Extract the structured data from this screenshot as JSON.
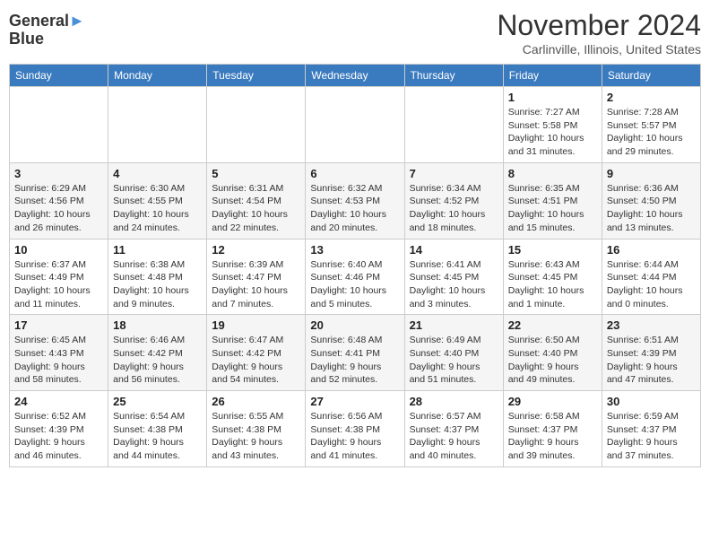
{
  "logo": {
    "line1": "General",
    "line2": "Blue"
  },
  "title": "November 2024",
  "location": "Carlinville, Illinois, United States",
  "weekdays": [
    "Sunday",
    "Monday",
    "Tuesday",
    "Wednesday",
    "Thursday",
    "Friday",
    "Saturday"
  ],
  "weeks": [
    [
      {
        "day": "",
        "info": ""
      },
      {
        "day": "",
        "info": ""
      },
      {
        "day": "",
        "info": ""
      },
      {
        "day": "",
        "info": ""
      },
      {
        "day": "",
        "info": ""
      },
      {
        "day": "1",
        "info": "Sunrise: 7:27 AM\nSunset: 5:58 PM\nDaylight: 10 hours and 31 minutes."
      },
      {
        "day": "2",
        "info": "Sunrise: 7:28 AM\nSunset: 5:57 PM\nDaylight: 10 hours and 29 minutes."
      }
    ],
    [
      {
        "day": "3",
        "info": "Sunrise: 6:29 AM\nSunset: 4:56 PM\nDaylight: 10 hours and 26 minutes."
      },
      {
        "day": "4",
        "info": "Sunrise: 6:30 AM\nSunset: 4:55 PM\nDaylight: 10 hours and 24 minutes."
      },
      {
        "day": "5",
        "info": "Sunrise: 6:31 AM\nSunset: 4:54 PM\nDaylight: 10 hours and 22 minutes."
      },
      {
        "day": "6",
        "info": "Sunrise: 6:32 AM\nSunset: 4:53 PM\nDaylight: 10 hours and 20 minutes."
      },
      {
        "day": "7",
        "info": "Sunrise: 6:34 AM\nSunset: 4:52 PM\nDaylight: 10 hours and 18 minutes."
      },
      {
        "day": "8",
        "info": "Sunrise: 6:35 AM\nSunset: 4:51 PM\nDaylight: 10 hours and 15 minutes."
      },
      {
        "day": "9",
        "info": "Sunrise: 6:36 AM\nSunset: 4:50 PM\nDaylight: 10 hours and 13 minutes."
      }
    ],
    [
      {
        "day": "10",
        "info": "Sunrise: 6:37 AM\nSunset: 4:49 PM\nDaylight: 10 hours and 11 minutes."
      },
      {
        "day": "11",
        "info": "Sunrise: 6:38 AM\nSunset: 4:48 PM\nDaylight: 10 hours and 9 minutes."
      },
      {
        "day": "12",
        "info": "Sunrise: 6:39 AM\nSunset: 4:47 PM\nDaylight: 10 hours and 7 minutes."
      },
      {
        "day": "13",
        "info": "Sunrise: 6:40 AM\nSunset: 4:46 PM\nDaylight: 10 hours and 5 minutes."
      },
      {
        "day": "14",
        "info": "Sunrise: 6:41 AM\nSunset: 4:45 PM\nDaylight: 10 hours and 3 minutes."
      },
      {
        "day": "15",
        "info": "Sunrise: 6:43 AM\nSunset: 4:45 PM\nDaylight: 10 hours and 1 minute."
      },
      {
        "day": "16",
        "info": "Sunrise: 6:44 AM\nSunset: 4:44 PM\nDaylight: 10 hours and 0 minutes."
      }
    ],
    [
      {
        "day": "17",
        "info": "Sunrise: 6:45 AM\nSunset: 4:43 PM\nDaylight: 9 hours and 58 minutes."
      },
      {
        "day": "18",
        "info": "Sunrise: 6:46 AM\nSunset: 4:42 PM\nDaylight: 9 hours and 56 minutes."
      },
      {
        "day": "19",
        "info": "Sunrise: 6:47 AM\nSunset: 4:42 PM\nDaylight: 9 hours and 54 minutes."
      },
      {
        "day": "20",
        "info": "Sunrise: 6:48 AM\nSunset: 4:41 PM\nDaylight: 9 hours and 52 minutes."
      },
      {
        "day": "21",
        "info": "Sunrise: 6:49 AM\nSunset: 4:40 PM\nDaylight: 9 hours and 51 minutes."
      },
      {
        "day": "22",
        "info": "Sunrise: 6:50 AM\nSunset: 4:40 PM\nDaylight: 9 hours and 49 minutes."
      },
      {
        "day": "23",
        "info": "Sunrise: 6:51 AM\nSunset: 4:39 PM\nDaylight: 9 hours and 47 minutes."
      }
    ],
    [
      {
        "day": "24",
        "info": "Sunrise: 6:52 AM\nSunset: 4:39 PM\nDaylight: 9 hours and 46 minutes."
      },
      {
        "day": "25",
        "info": "Sunrise: 6:54 AM\nSunset: 4:38 PM\nDaylight: 9 hours and 44 minutes."
      },
      {
        "day": "26",
        "info": "Sunrise: 6:55 AM\nSunset: 4:38 PM\nDaylight: 9 hours and 43 minutes."
      },
      {
        "day": "27",
        "info": "Sunrise: 6:56 AM\nSunset: 4:38 PM\nDaylight: 9 hours and 41 minutes."
      },
      {
        "day": "28",
        "info": "Sunrise: 6:57 AM\nSunset: 4:37 PM\nDaylight: 9 hours and 40 minutes."
      },
      {
        "day": "29",
        "info": "Sunrise: 6:58 AM\nSunset: 4:37 PM\nDaylight: 9 hours and 39 minutes."
      },
      {
        "day": "30",
        "info": "Sunrise: 6:59 AM\nSunset: 4:37 PM\nDaylight: 9 hours and 37 minutes."
      }
    ]
  ]
}
